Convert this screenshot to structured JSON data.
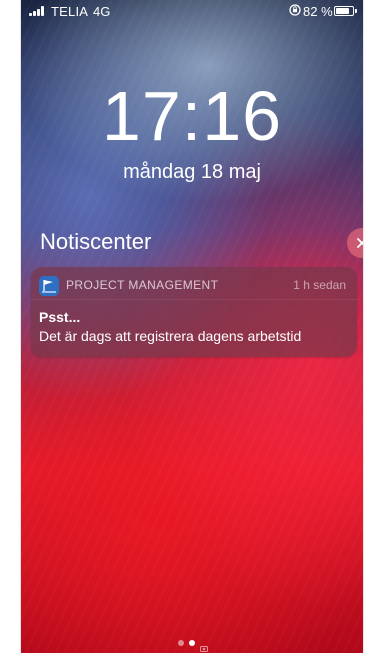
{
  "status_bar": {
    "carrier": "TELIA",
    "network": "4G",
    "battery_percent": "82 %",
    "battery_level": 0.82,
    "icons": [
      "signal-icon",
      "rotation-lock-icon",
      "battery-icon"
    ]
  },
  "lock_screen": {
    "time": "17:16",
    "date": "måndag 18 maj"
  },
  "notification_center": {
    "title": "Notiscenter",
    "clear_icon": "close-icon"
  },
  "notifications": [
    {
      "app_name": "PROJECT MANAGEMENT",
      "time_ago": "1 h sedan",
      "title": "Psst...",
      "body": "Det är dags att registrera dagens arbetstid",
      "icon": "project-management-app-icon"
    }
  ],
  "pager": {
    "pages": 3,
    "active_index": 1,
    "last_icon": "camera-icon"
  },
  "colors": {
    "notification_bg": "#783748",
    "clear_button_bg": "#ff7882"
  }
}
